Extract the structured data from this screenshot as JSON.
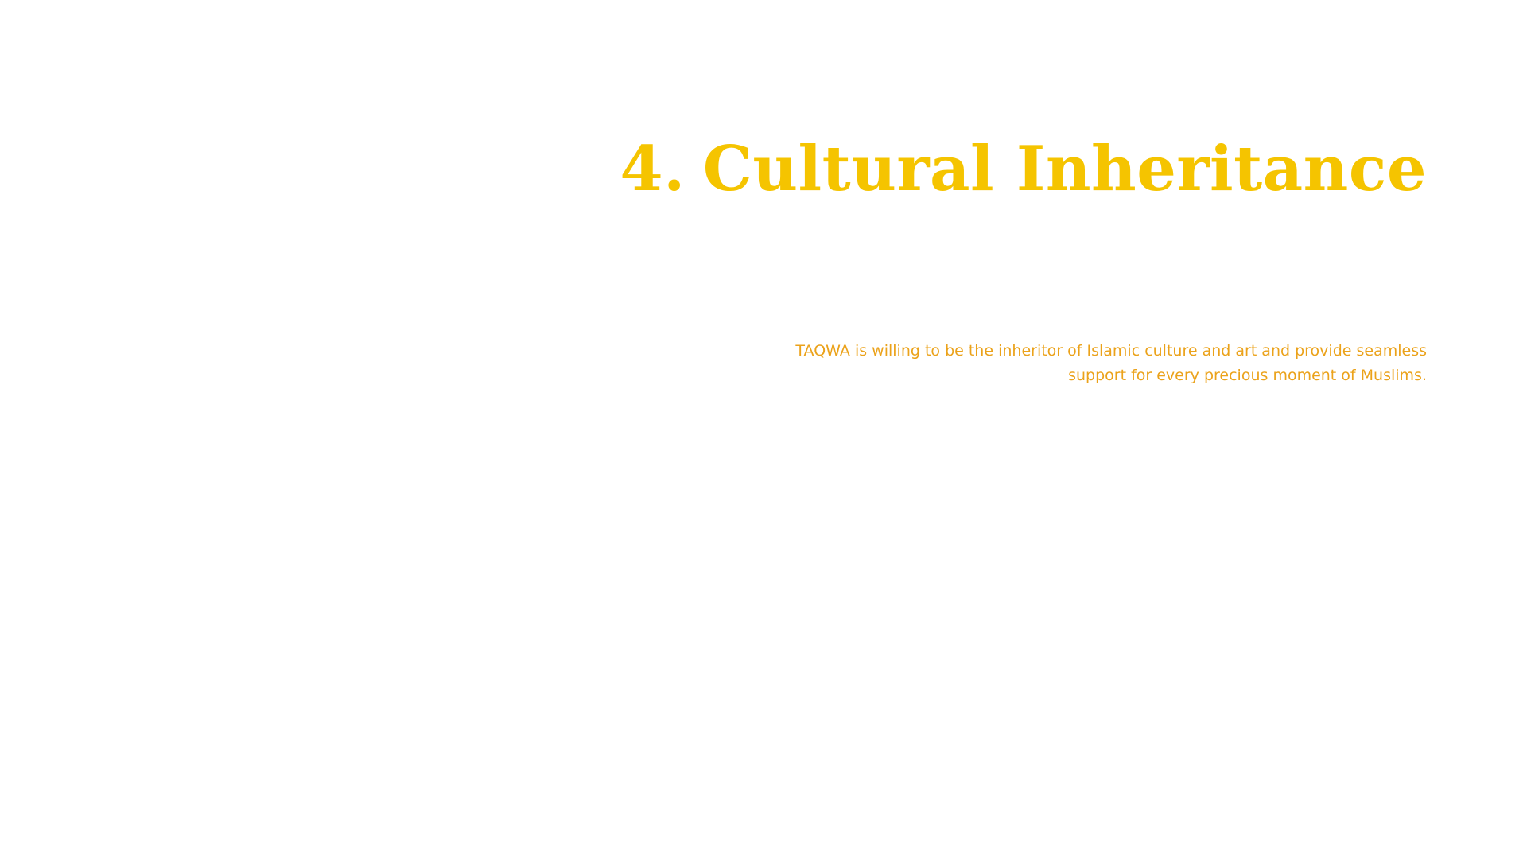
{
  "section": {
    "number": "4.",
    "title": "Cultural Inheritance",
    "title_color": "#F5C400",
    "description": "TAQWA is willing to be the inheritor of Islamic culture and art and provide seamless support for every precious moment of Muslims.",
    "description_color": "#EBA21A"
  },
  "background_color": "#FFFFFF"
}
